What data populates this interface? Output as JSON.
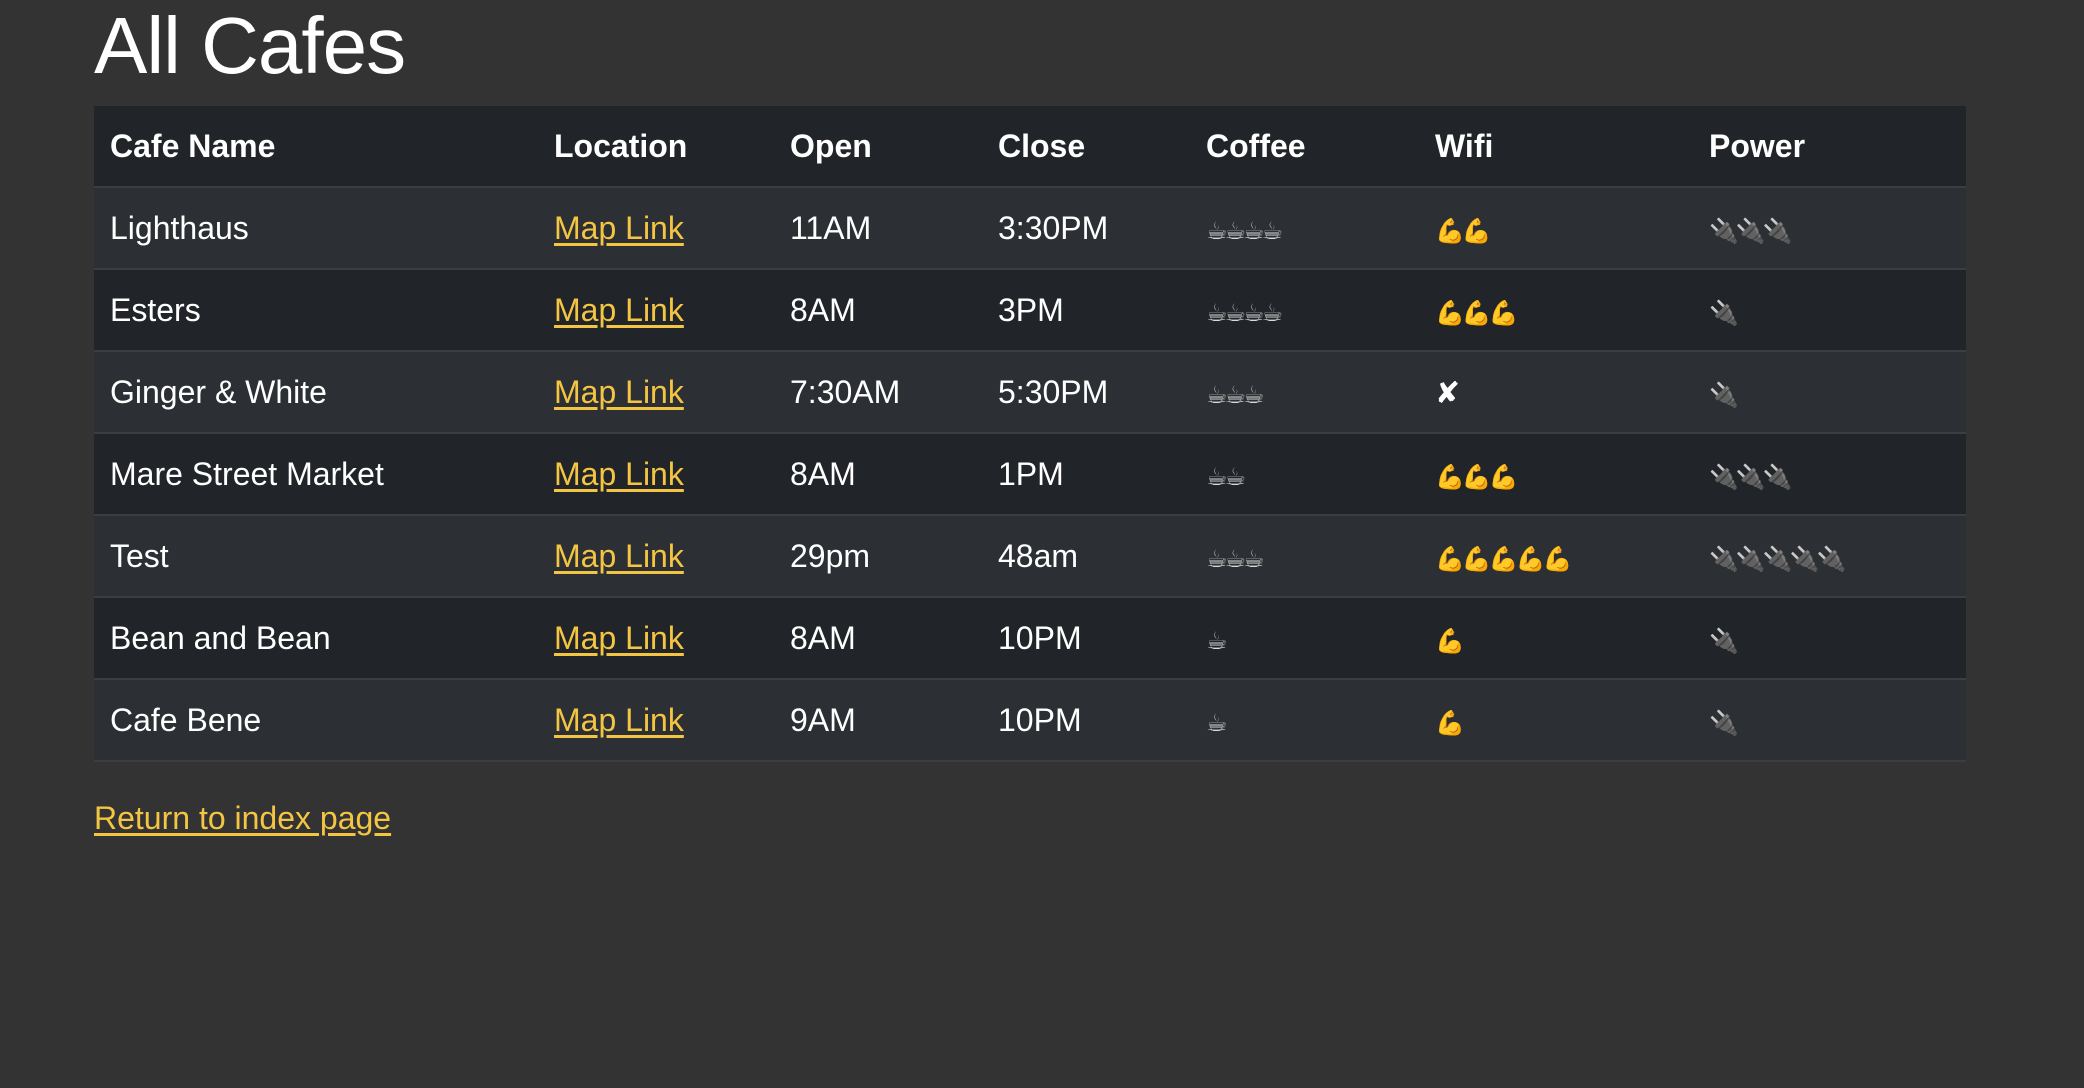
{
  "page": {
    "title": "All Cafes",
    "return_link": "Return to index page"
  },
  "table": {
    "headers": [
      "Cafe Name",
      "Location",
      "Open",
      "Close",
      "Coffee",
      "Wifi",
      "Power"
    ],
    "rows": [
      {
        "name": "Lighthaus",
        "location": "Map Link",
        "open": "11AM",
        "close": "3:30PM",
        "coffee": "☕☕☕☕",
        "wifi": "💪💪",
        "power": "🔌🔌🔌"
      },
      {
        "name": "Esters",
        "location": "Map Link",
        "open": "8AM",
        "close": "3PM",
        "coffee": "☕☕☕☕",
        "wifi": "💪💪💪",
        "power": "🔌"
      },
      {
        "name": "Ginger & White",
        "location": "Map Link",
        "open": "7:30AM",
        "close": "5:30PM",
        "coffee": "☕☕☕",
        "wifi": "✘",
        "power": "🔌"
      },
      {
        "name": "Mare Street Market",
        "location": "Map Link",
        "open": "8AM",
        "close": "1PM",
        "coffee": "☕☕",
        "wifi": "💪💪💪",
        "power": "🔌🔌🔌"
      },
      {
        "name": "Test",
        "location": "Map Link",
        "open": "29pm",
        "close": "48am",
        "coffee": "☕☕☕",
        "wifi": "💪💪💪💪💪",
        "power": "🔌🔌🔌🔌🔌"
      },
      {
        "name": "Bean and Bean",
        "location": "Map Link",
        "open": "8AM",
        "close": "10PM",
        "coffee": "☕",
        "wifi": "💪",
        "power": "🔌"
      },
      {
        "name": "Cafe Bene",
        "location": "Map Link",
        "open": "9AM",
        "close": "10PM",
        "coffee": "☕",
        "wifi": "💪",
        "power": "🔌"
      }
    ]
  },
  "colors": {
    "background": "#333333",
    "header_row": "#212529",
    "row_odd": "#2c3034",
    "row_even": "#212529",
    "link": "#f4c542"
  }
}
